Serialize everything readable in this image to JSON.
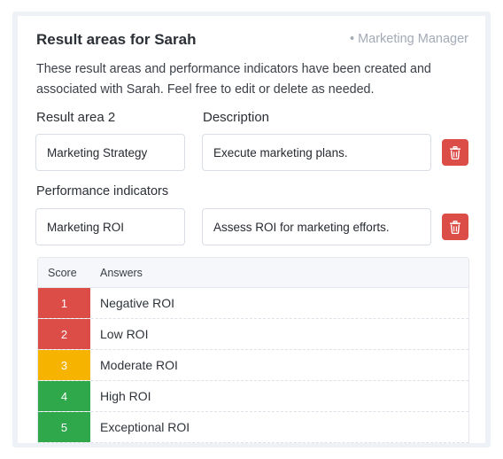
{
  "header": {
    "title": "Result areas for Sarah",
    "role": "• Marketing Manager"
  },
  "intro": "These result areas and performance indicators have been created and associated with Sarah. Feel free to edit or delete as needed.",
  "result_area": {
    "label": "Result area 2",
    "description_label": "Description",
    "name_value": "Marketing Strategy",
    "description_value": "Execute marketing plans."
  },
  "performance": {
    "label": "Performance indicators",
    "name_value": "Marketing ROI",
    "description_value": "Assess ROI for marketing efforts."
  },
  "table": {
    "headers": {
      "score": "Score",
      "answers": "Answers"
    },
    "rows": [
      {
        "score": "1",
        "answer": "Negative ROI",
        "color": "#dc4d47"
      },
      {
        "score": "2",
        "answer": "Low ROI",
        "color": "#dc4d47"
      },
      {
        "score": "3",
        "answer": "Moderate ROI",
        "color": "#f6b400"
      },
      {
        "score": "4",
        "answer": "High ROI",
        "color": "#2ea84a"
      },
      {
        "score": "5",
        "answer": "Exceptional ROI",
        "color": "#2ea84a"
      }
    ]
  },
  "icons": {
    "delete": "trash-icon"
  },
  "colors": {
    "danger": "#dc4d47",
    "warning": "#f6b400",
    "success": "#2ea84a",
    "muted": "#a3abb6"
  }
}
